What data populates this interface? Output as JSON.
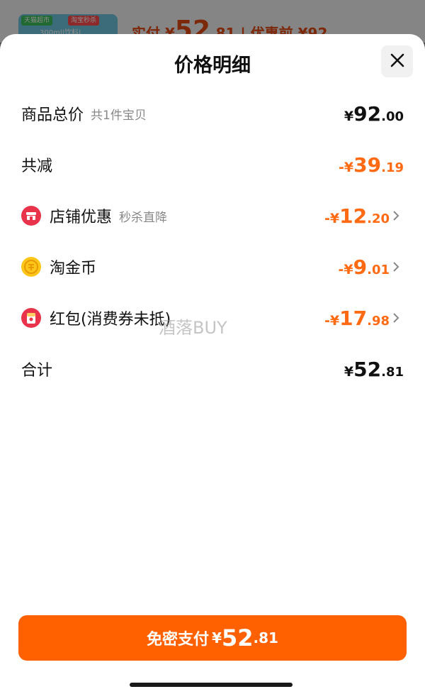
{
  "background": {
    "thumb_tag_left": "天猫超市",
    "thumb_tag_right": "淘宝秒杀",
    "thumb_text": "300ml|饮料|",
    "actual_label": "实付",
    "actual_sign": "¥",
    "actual_int": "52",
    "actual_dec": ".81",
    "orig_label": "| 优惠前 ¥92"
  },
  "sheet": {
    "title": "价格明细",
    "total": {
      "label": "商品总价",
      "sub": "共1件宝贝",
      "sign": "¥",
      "int": "92",
      "dec": ".00"
    },
    "reduce": {
      "label": "共减",
      "sign": "-¥",
      "int": "39",
      "dec": ".19"
    },
    "shop_discount": {
      "label": "店铺优惠",
      "sub": "秒杀直降",
      "sign": "-¥",
      "int": "12",
      "dec": ".20"
    },
    "coins": {
      "label": "淘金币",
      "sign": "-¥",
      "int": "9",
      "dec": ".01"
    },
    "redpacket": {
      "label": "红包(消费券未抵)",
      "sign": "-¥",
      "int": "17",
      "dec": ".98"
    },
    "sum": {
      "label": "合计",
      "sign": "¥",
      "int": "52",
      "dec": ".81"
    },
    "watermark": "酒落BUY"
  },
  "pay_button": {
    "label": "免密支付",
    "sign": "¥",
    "int": "52",
    "dec": ".81"
  },
  "colors": {
    "accent": "#ff6100",
    "discount": "#ff6a13",
    "shop_icon": "#e8334a",
    "coin_icon": "#ffc61a"
  },
  "icons": [
    "close-icon",
    "shop-icon",
    "coin-icon",
    "red-packet-icon",
    "chevron-right-icon"
  ]
}
